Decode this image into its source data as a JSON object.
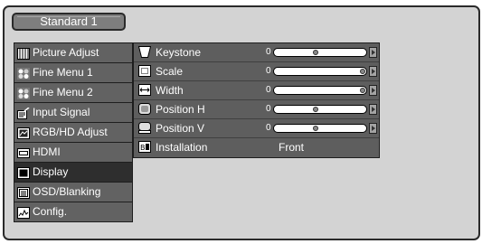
{
  "header": {
    "tab_label": "Standard 1"
  },
  "sidebar": {
    "items": [
      {
        "label": "Picture Adjust",
        "icon": "picture-adjust-icon",
        "active": false
      },
      {
        "label": "Fine Menu 1",
        "icon": "fine-menu-icon",
        "active": false
      },
      {
        "label": "Fine Menu 2",
        "icon": "fine-menu-icon",
        "active": false
      },
      {
        "label": "Input Signal",
        "icon": "input-signal-icon",
        "active": false
      },
      {
        "label": "RGB/HD Adjust",
        "icon": "rgb-hd-icon",
        "active": false
      },
      {
        "label": "HDMI",
        "icon": "hdmi-icon",
        "active": false
      },
      {
        "label": "Display",
        "icon": "display-icon",
        "active": true
      },
      {
        "label": "OSD/Blanking",
        "icon": "osd-blanking-icon",
        "active": false
      },
      {
        "label": "Config.",
        "icon": "config-icon",
        "active": false
      }
    ]
  },
  "settings": {
    "rows": [
      {
        "label": "Keystone",
        "icon": "keystone-icon",
        "zero": "0",
        "level": 0.45
      },
      {
        "label": "Scale",
        "icon": "scale-icon",
        "zero": "0",
        "level": 1.0
      },
      {
        "label": "Width",
        "icon": "width-icon",
        "zero": "0",
        "level": 1.0
      },
      {
        "label": "Position H",
        "icon": "position-h-icon",
        "zero": "0",
        "level": 0.45
      },
      {
        "label": "Position V",
        "icon": "position-v-icon",
        "zero": "0",
        "level": 0.45
      }
    ],
    "installation": {
      "label": "Installation",
      "icon": "installation-icon",
      "value": "Front"
    }
  }
}
